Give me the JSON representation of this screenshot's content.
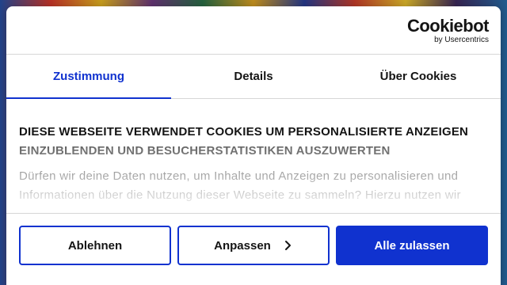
{
  "logo": {
    "brand": "Cookiebot",
    "subtitle": "by Usercentrics"
  },
  "tabs": [
    {
      "label": "Zustimmung",
      "active": true
    },
    {
      "label": "Details",
      "active": false
    },
    {
      "label": "Über Cookies",
      "active": false
    }
  ],
  "content": {
    "heading": "DIESE WEBSEITE VERWENDET COOKIES UM PERSONALISIERTE ANZEIGEN EINZUBLENDEN UND BESUCHERSTATISTIKEN AUSZUWERTEN",
    "body": "Dürfen wir deine Daten nutzen, um Inhalte und Anzeigen zu personalisieren und Informationen über die Nutzung dieser Webseite zu sammeln? Hierzu nutzen wir"
  },
  "buttons": {
    "decline": "Ablehnen",
    "customize": "Anpassen",
    "allow_all": "Alle zulassen"
  },
  "colors": {
    "accent": "#1032cf",
    "text": "#141414",
    "divider": "#d6d6d6"
  }
}
